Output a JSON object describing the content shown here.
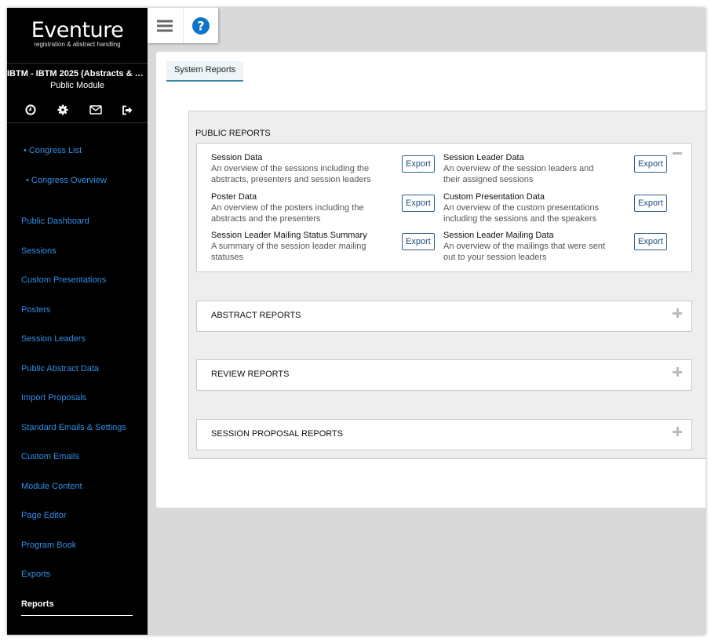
{
  "sidebar": {
    "logo": "Eventure",
    "tagline": "registration & abstract handling",
    "event_title": "IBTM - IBTM 2025 (Abstracts & Par...",
    "module": "Public Module",
    "icons": [
      "clock-icon",
      "gear-icon",
      "envelope-icon",
      "logout-icon"
    ],
    "sub_items": [
      "• Congress List",
      "• Congress Overview"
    ],
    "items": [
      "Public Dashboard",
      "Sessions",
      "Custom Presentations",
      "Posters",
      "Session Leaders",
      "Public Abstract Data",
      "Import Proposals",
      "Standard Emails & Settings",
      "Custom Emails",
      "Module Content",
      "Page Editor",
      "Program Book",
      "Exports",
      "Reports"
    ],
    "active_item": "Reports"
  },
  "topbar": {
    "icons": [
      "hamburger-menu-icon",
      "help-icon"
    ]
  },
  "tab": {
    "label": "System Reports"
  },
  "colors": {
    "accent_blue": "#2f8fe8",
    "tab_underline": "#3a87ad",
    "help_blue": "#1074c9"
  },
  "sections": {
    "public": {
      "title": "PUBLIC REPORTS",
      "export_label": "Export",
      "reports": [
        {
          "name": "Session Data",
          "desc": "An overview of the sessions including the abstracts, presenters and session leaders"
        },
        {
          "name": "Session Leader Data",
          "desc": "An overview of the session leaders and their assigned sessions"
        },
        {
          "name": "Poster Data",
          "desc": "An overview of the posters including the abstracts and the presenters"
        },
        {
          "name": "Custom Presentation Data",
          "desc": "An overview of the custom presentations including the sessions and the speakers"
        },
        {
          "name": "Session Leader Mailing Status Summary",
          "desc": "A summary of the session leader mailing statuses"
        },
        {
          "name": "Session Leader Mailing Data",
          "desc": "An overview of the mailings that were sent out to your session leaders"
        }
      ]
    },
    "abstract": {
      "title": "ABSTRACT REPORTS"
    },
    "review": {
      "title": "REVIEW REPORTS"
    },
    "session_proposal": {
      "title": "SESSION PROPOSAL REPORTS"
    }
  }
}
